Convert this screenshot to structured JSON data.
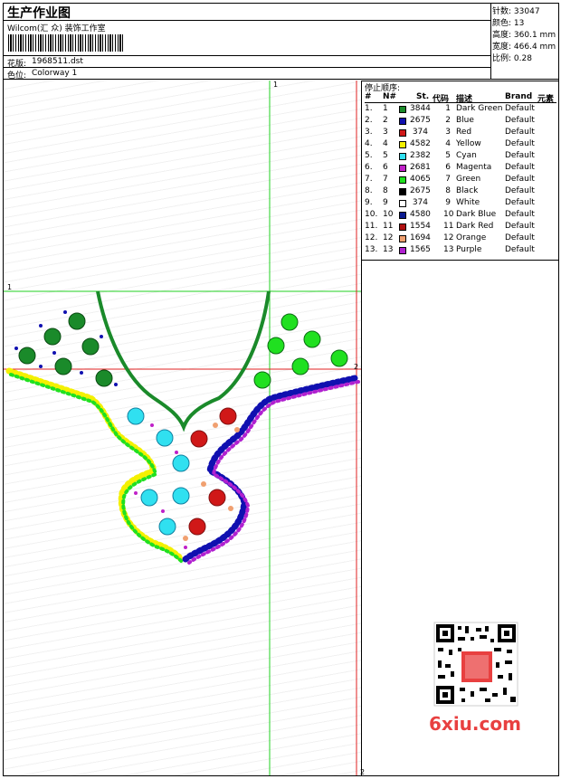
{
  "header": {
    "title": "生产作业图",
    "studio": "Wilcom(汇 众) 装饰工作室",
    "design_label": "花版:",
    "design_file": "1968511.dst",
    "colorway_label": "色位:",
    "colorway": "Colorway 1"
  },
  "stats": [
    {
      "label": "针数:",
      "value": "33047"
    },
    {
      "label": "颜色:",
      "value": "13"
    },
    {
      "label": "高度:",
      "value": "360.1 mm"
    },
    {
      "label": "宽度:",
      "value": "466.4 mm"
    },
    {
      "label": "比例:",
      "value": "0.28"
    }
  ],
  "stop_sequence": {
    "title": "停止顺序:",
    "columns": [
      "#",
      "N#",
      "St.",
      "代码",
      "描述",
      "Brand",
      "元素"
    ],
    "rows": [
      {
        "idx": "1.",
        "n": "1",
        "color": "#1a8a2a",
        "st": "3844",
        "code": "1",
        "desc": "Dark Green",
        "brand": "Default"
      },
      {
        "idx": "2.",
        "n": "2",
        "color": "#1010b0",
        "st": "2675",
        "code": "2",
        "desc": "Blue",
        "brand": "Default"
      },
      {
        "idx": "3.",
        "n": "3",
        "color": "#d01818",
        "st": "374",
        "code": "3",
        "desc": "Red",
        "brand": "Default"
      },
      {
        "idx": "4.",
        "n": "4",
        "color": "#f4f000",
        "st": "4582",
        "code": "4",
        "desc": "Yellow",
        "brand": "Default"
      },
      {
        "idx": "5.",
        "n": "5",
        "color": "#30e0f0",
        "st": "2382",
        "code": "5",
        "desc": "Cyan",
        "brand": "Default"
      },
      {
        "idx": "6.",
        "n": "6",
        "color": "#c020c8",
        "st": "2681",
        "code": "6",
        "desc": "Magenta",
        "brand": "Default"
      },
      {
        "idx": "7.",
        "n": "7",
        "color": "#20e020",
        "st": "4065",
        "code": "7",
        "desc": "Green",
        "brand": "Default"
      },
      {
        "idx": "8.",
        "n": "8",
        "color": "#000000",
        "st": "2675",
        "code": "8",
        "desc": "Black",
        "brand": "Default"
      },
      {
        "idx": "9.",
        "n": "9",
        "color": "#ffffff",
        "st": "374",
        "code": "9",
        "desc": "White",
        "brand": "Default"
      },
      {
        "idx": "10.",
        "n": "10",
        "color": "#0a1a90",
        "st": "4580",
        "code": "10",
        "desc": "Dark Blue",
        "brand": "Default"
      },
      {
        "idx": "11.",
        "n": "11",
        "color": "#b01010",
        "st": "1554",
        "code": "11",
        "desc": "Dark Red",
        "brand": "Default"
      },
      {
        "idx": "12.",
        "n": "12",
        "color": "#f0a070",
        "st": "1694",
        "code": "12",
        "desc": "Orange",
        "brand": "Default"
      },
      {
        "idx": "13.",
        "n": "13",
        "color": "#b020d0",
        "st": "1565",
        "code": "13",
        "desc": "Purple",
        "brand": "Default"
      }
    ]
  },
  "canvas": {
    "marker_top": "1",
    "marker_left": "1",
    "marker_right": "2",
    "marker_bottom": "2"
  },
  "watermark": {
    "text": "6xiu.com",
    "color": "#e84040"
  }
}
